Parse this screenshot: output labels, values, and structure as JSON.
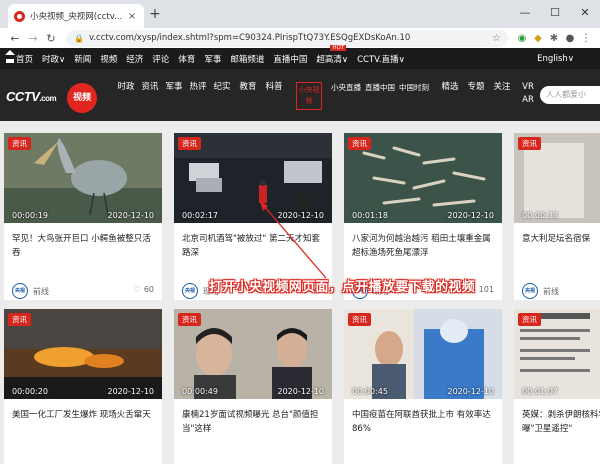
{
  "browser": {
    "tab_title": "小央视频_央视网(cctv...",
    "tab_close": "×",
    "new_tab": "+",
    "win_min": "—",
    "win_max": "☐",
    "win_close": "✕",
    "url": "v.cctv.com/xysp/index.shtml?spm=C90324.PIrispTtQ73Y.ESQgEXDsKoAn.10"
  },
  "topnav": {
    "items": [
      "首页",
      "时政∨",
      "新闻",
      "视频",
      "经济",
      "评论",
      "体育",
      "军事",
      "邮箱频道",
      "直播中国",
      "超高清∨",
      "CCTV.直播∨"
    ],
    "hot_badge": "HOT",
    "language": "English∨"
  },
  "secnav": {
    "logo_text": "CCTV",
    "logo_sub": ".com",
    "logo_cn": "央视网",
    "logo_badge": "视频",
    "categories": [
      "时政",
      "资讯",
      "军事",
      "热评",
      "纪实",
      "教育",
      "科普"
    ],
    "boxed": "小央视频",
    "live": [
      "小央直播",
      "直播中国",
      "中国时刻"
    ],
    "more": [
      "精选",
      "专题",
      "关注",
      "VR AR"
    ],
    "search_placeholder": "人人都爱小"
  },
  "cards": [
    {
      "tag": "资讯",
      "duration": "00:00:19",
      "date": "2020-12-10",
      "title": "罕见！大鸟张开巨口 小鳄鱼被整只活吞",
      "source": "前线",
      "likes": "60"
    },
    {
      "tag": "资讯",
      "duration": "00:02:17",
      "date": "2020-12-10",
      "title": "北京司机酒驾\"被放过\" 第二天才知套路深",
      "source": "现场",
      "likes": "42"
    },
    {
      "tag": "资讯",
      "duration": "00:01:18",
      "date": "2020-12-10",
      "title": "八家河为何越治越污 稻田土壤重金属超标渔场死鱼尾漂浮",
      "source": "现场",
      "likes": "101"
    },
    {
      "tag": "资讯",
      "duration": "00:00:33",
      "date": "2020-12-10",
      "title": "意大利足坛名宿保",
      "source": "前线",
      "likes": ""
    },
    {
      "tag": "资讯",
      "duration": "00:00:20",
      "date": "2020-12-10",
      "title": "美国一化工厂发生爆炸 现场火舌窜天",
      "source": "",
      "likes": ""
    },
    {
      "tag": "资讯",
      "duration": "00:00:49",
      "date": "2020-12-10",
      "title": "康楠21岁面试视频曝光 总台\"颜值担当\"这样",
      "source": "",
      "likes": ""
    },
    {
      "tag": "资讯",
      "duration": "00:00:45",
      "date": "2020-12-10",
      "title": "中国疫苗在阿联酋获批上市 有效率达86%",
      "source": "",
      "likes": ""
    },
    {
      "tag": "资讯",
      "duration": "00:01:07",
      "date": "2020-12-10",
      "title": "英媒：剥杀伊朗核科学家的武器被曝\"卫星遥控\"",
      "source": "",
      "likes": ""
    }
  ],
  "annotation": "打开小央视频网页面，点开播放要下载的视频"
}
